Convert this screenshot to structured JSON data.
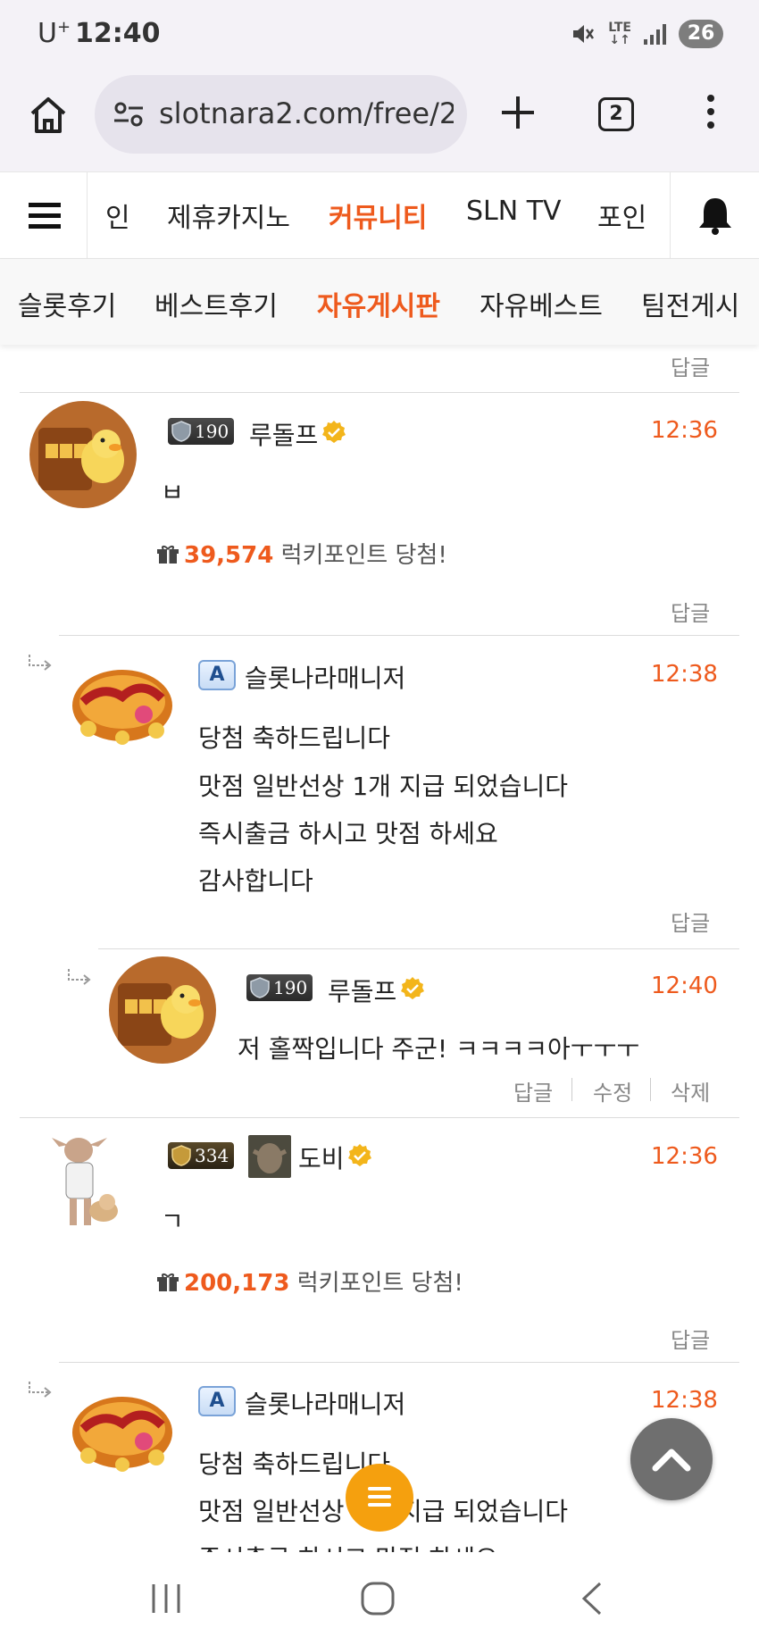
{
  "status_bar": {
    "carrier": "U",
    "carrier_sup": "+",
    "time": "12:40",
    "network": "LTE",
    "battery": "26"
  },
  "browser": {
    "url": "slotnara2.com/free/2",
    "tab_count": "2"
  },
  "site_nav": {
    "items": [
      "인",
      "제휴카지노",
      "커뮤니티",
      "SLN TV",
      "포인"
    ],
    "active_index": 2
  },
  "sub_nav": {
    "items": [
      "슬롯후기",
      "베스트후기",
      "자유게시판",
      "자유베스트",
      "팀전게시"
    ],
    "active_index": 2
  },
  "labels": {
    "reply": "답글",
    "edit": "수정",
    "delete": "삭제",
    "lucky_suffix": "럭키포인트 당첨!"
  },
  "comments": [
    {
      "level": "190",
      "nickname": "루돌프",
      "time": "12:36",
      "text": "ㅂ",
      "lucky_points": "39,574"
    },
    {
      "badge": "A",
      "nickname": "슬롯나라매니저",
      "time": "12:38",
      "lines": [
        "당첨 축하드립니다",
        "맛점 일반선상 1개 지급 되었습니다",
        "즉시출금 하시고 맛점 하세요",
        "감사합니다"
      ]
    },
    {
      "level": "190",
      "nickname": "루돌프",
      "time": "12:40",
      "text": "저 홀짝입니다 주군! ㅋㅋㅋㅋ아ㅜㅜㅜ"
    },
    {
      "level": "334",
      "nickname": "도비",
      "time": "12:36",
      "text": "ㄱ",
      "lucky_points": "200,173"
    },
    {
      "badge": "A",
      "nickname": "슬롯나라매니저",
      "time": "12:38",
      "lines": [
        "당첨 축하드립니다",
        "맛점 일반선상 1개 지급 되었습니다",
        "즉시출금 하시고 맛점 하세요"
      ]
    }
  ],
  "colors": {
    "accent": "#ee5a1d",
    "fab_menu": "#f5a00e",
    "fab_top": "#6f6f6f"
  },
  "icons": [
    "home-icon",
    "tune-icon",
    "plus-icon",
    "tabs-icon",
    "more-icon",
    "menu-icon",
    "bell-icon",
    "gift-icon",
    "verified-icon",
    "reply-arrow-icon",
    "chevron-up-icon",
    "recents-icon",
    "home-nav-icon",
    "back-icon"
  ]
}
